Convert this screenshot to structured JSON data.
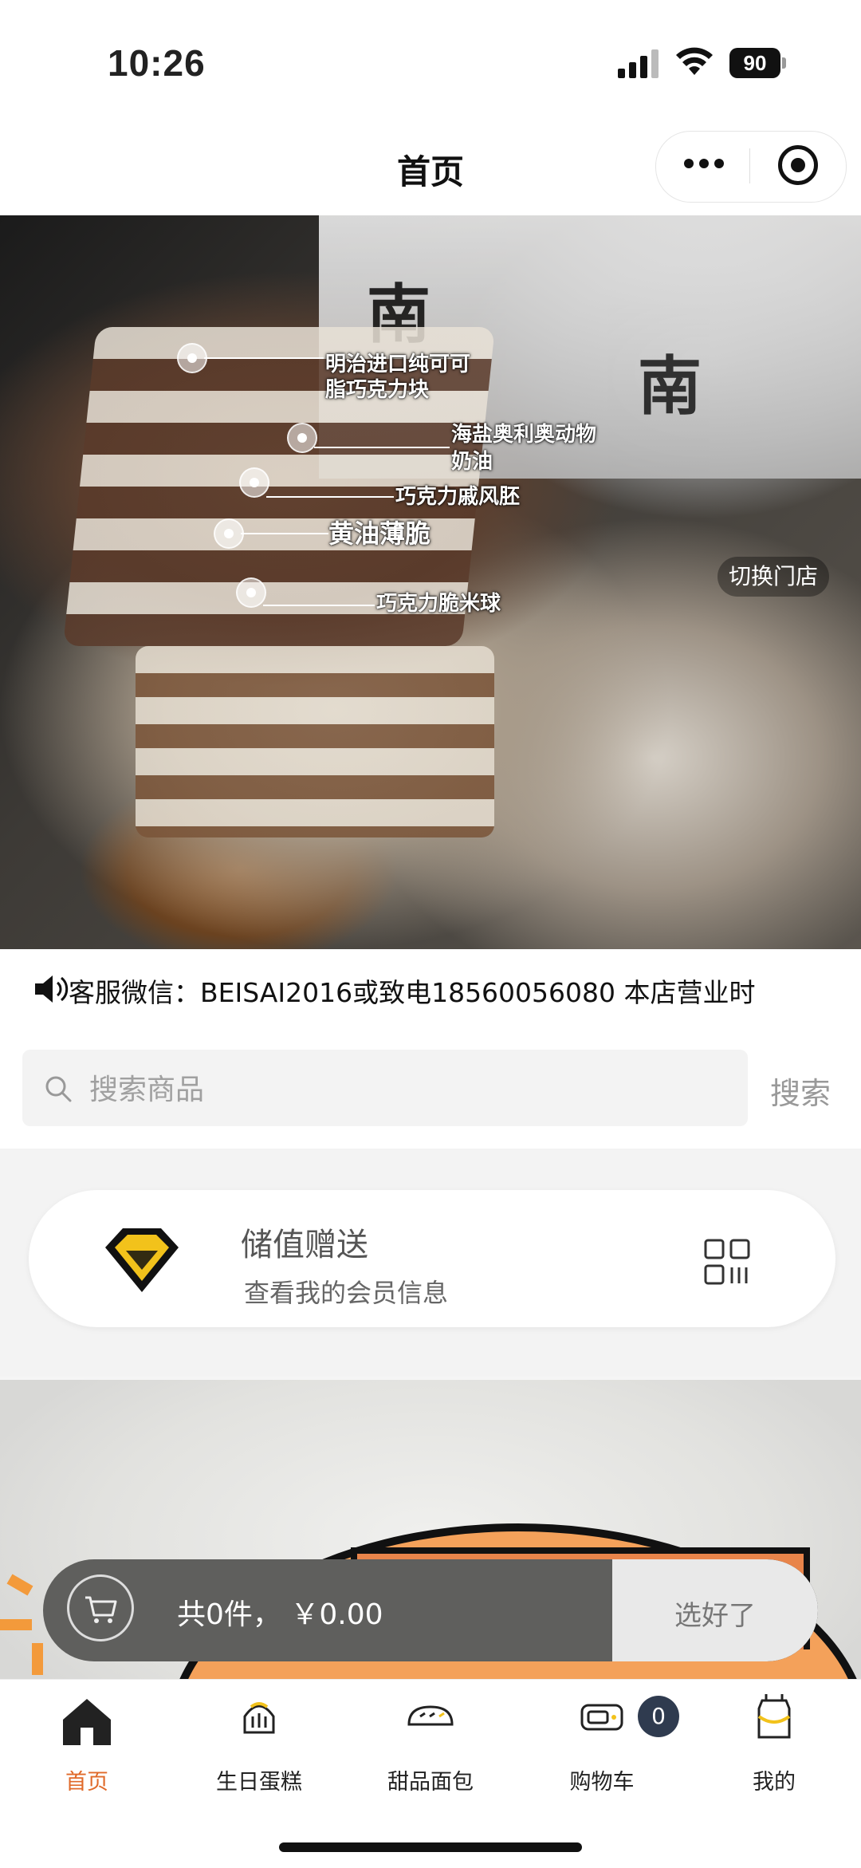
{
  "status_bar": {
    "time": "10:26",
    "battery": "90"
  },
  "nav": {
    "title": "首页"
  },
  "banner": {
    "switch_store": "切换门店",
    "box_text": "南",
    "labels": [
      "明治进口纯可可",
      "脂巧克力块",
      "海盐奥利奥动物",
      "奶油",
      "巧克力戚风胚",
      "黄油薄脆",
      "巧克力脆米球"
    ]
  },
  "notice": {
    "text": "客服微信：BEISAI2016或致电18560056080  本店营业时"
  },
  "search": {
    "placeholder": "搜索商品",
    "button": "搜索"
  },
  "member": {
    "title": "储值赠送",
    "subtitle": "查看我的会员信息"
  },
  "cart": {
    "summary": "共0件，  ￥0.00",
    "done": "选好了"
  },
  "tabs": [
    {
      "label": "首页",
      "icon": "home-icon"
    },
    {
      "label": "生日蛋糕",
      "icon": "cake-icon"
    },
    {
      "label": "甜品面包",
      "icon": "bread-icon"
    },
    {
      "label": "购物车",
      "icon": "cart-icon",
      "badge": "0"
    },
    {
      "label": "我的",
      "icon": "profile-icon"
    }
  ],
  "colors": {
    "accent": "#e06a2a",
    "badge": "#2f3b4f",
    "diamond": "#f2c21b"
  }
}
